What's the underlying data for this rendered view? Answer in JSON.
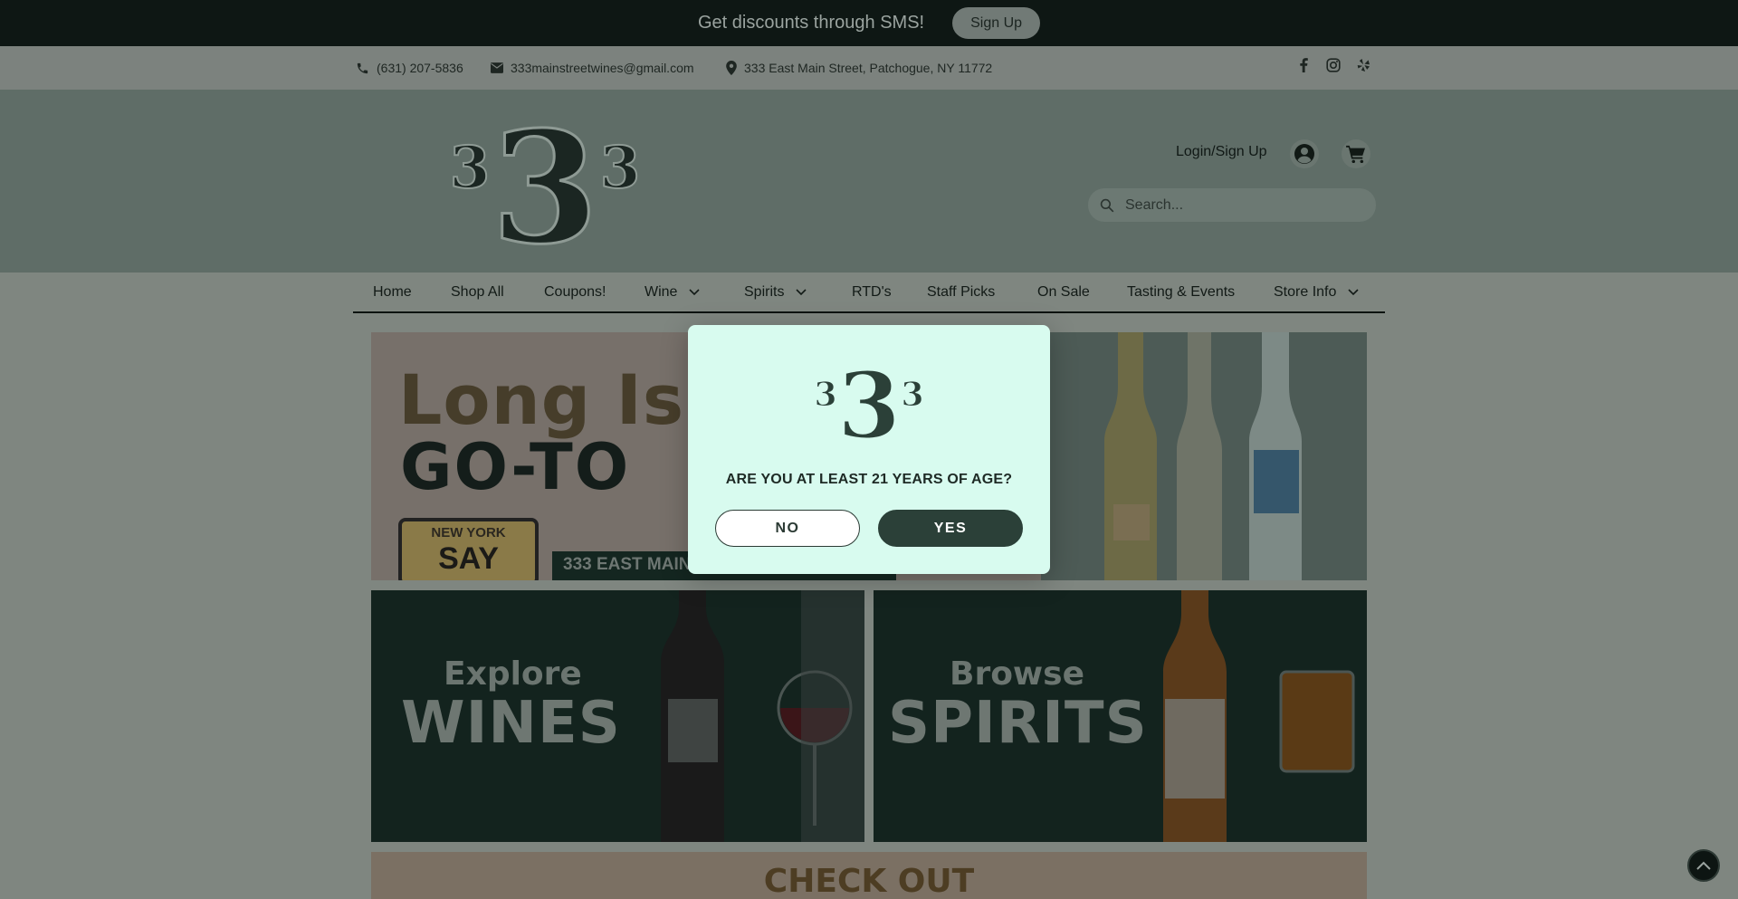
{
  "sms_bar": {
    "text": "Get discounts through SMS!",
    "button": "Sign Up"
  },
  "contact": {
    "phone": "(631) 207-5836",
    "email": "333mainstreetwines@gmail.com",
    "address": "333 East Main Street, Patchogue, NY 11772",
    "social_icons": [
      "facebook-icon",
      "instagram-icon",
      "yelp-icon"
    ]
  },
  "header": {
    "logo_alt": "333",
    "login": "Login/Sign Up",
    "search_placeholder": "Search..."
  },
  "nav": {
    "items": [
      {
        "label": "Home"
      },
      {
        "label": "Shop All"
      },
      {
        "label": "Coupons!"
      },
      {
        "label": "Wine",
        "dropdown": true
      },
      {
        "label": "Spirits",
        "dropdown": true
      },
      {
        "label": "RTD's"
      },
      {
        "label": "Staff Picks"
      },
      {
        "label": "On Sale"
      },
      {
        "label": "Tasting & Events"
      },
      {
        "label": "Store Info",
        "dropdown": true
      }
    ]
  },
  "hero": {
    "line1": "Long Isl",
    "line2": "GO-TO",
    "plate_top": "NEW YORK",
    "plate_main": "SAY HELLO",
    "address": "333 EAST MAIN"
  },
  "banners": {
    "wines_small": "Explore",
    "wines_big": "WINES",
    "spirits_small": "Browse",
    "spirits_big": "SPIRITS",
    "checkout": "CHECK OUT"
  },
  "age_gate": {
    "question": "ARE YOU AT LEAST 21 YEARS OF AGE?",
    "no": "NO",
    "yes": "YES"
  },
  "colors": {
    "modal_bg": "#d8fbef",
    "brand_green": "#2b4038",
    "overlay_tint": "#7f8680"
  }
}
